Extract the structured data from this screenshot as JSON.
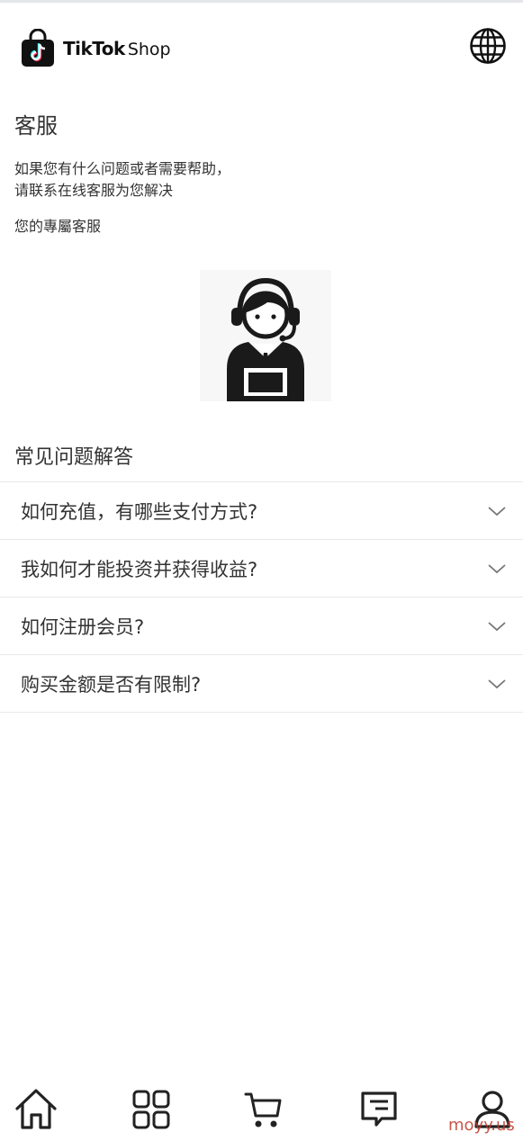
{
  "header": {
    "brand_primary": "TikTok",
    "brand_secondary": "Shop",
    "logo_icon": "tiktok-shop-bag-icon",
    "language_icon": "globe-icon"
  },
  "page": {
    "title": "客服",
    "description_line1": "如果您有什么问题或者需要帮助，",
    "description_line2": "请联系在线客服为您解决",
    "exclusive_label": "您的專屬客服",
    "agent_icon": "customer-service-agent-icon"
  },
  "faq": {
    "title": "常见问题解答",
    "items": [
      {
        "question": "如何充值，有哪些支付方式?"
      },
      {
        "question": "我如何才能投资并获得收益?"
      },
      {
        "question": "如何注册会员?"
      },
      {
        "question": "购买金额是否有限制?"
      }
    ]
  },
  "bottom_nav": {
    "items": [
      {
        "icon": "home-icon"
      },
      {
        "icon": "categories-icon"
      },
      {
        "icon": "cart-icon"
      },
      {
        "icon": "message-icon"
      },
      {
        "icon": "user-icon"
      }
    ]
  },
  "watermark": "moyy.us",
  "colors": {
    "text": "#333333",
    "divider": "#e8e8e8",
    "watermark": "#c0392b",
    "tiktok_cyan": "#25f4ee",
    "tiktok_pink": "#fe2c55"
  }
}
